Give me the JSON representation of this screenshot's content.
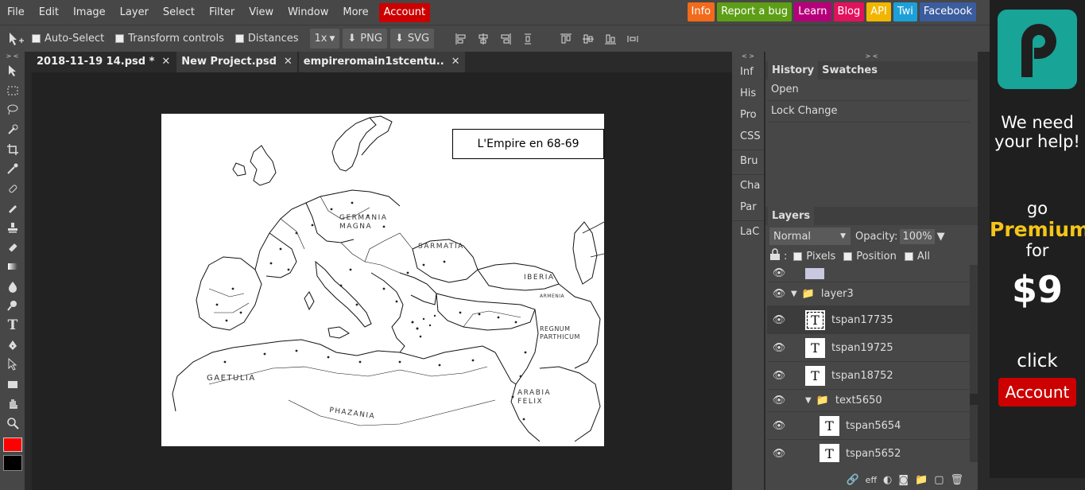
{
  "menubar": {
    "items": [
      "File",
      "Edit",
      "Image",
      "Layer",
      "Select",
      "Filter",
      "View",
      "Window",
      "More"
    ],
    "account": "Account"
  },
  "extlinks": [
    {
      "label": "Info",
      "color": "#f26a1b"
    },
    {
      "label": "Report a bug",
      "color": "#5d9e16"
    },
    {
      "label": "Learn",
      "color": "#b5007a"
    },
    {
      "label": "Blog",
      "color": "#e1125d"
    },
    {
      "label": "API",
      "color": "#f1b600"
    },
    {
      "label": "Twi",
      "color": "#1d9fd8"
    },
    {
      "label": "Facebook",
      "color": "#3b5c9d"
    }
  ],
  "toolbar": {
    "auto_select": "Auto-Select",
    "transform_controls": "Transform controls",
    "distances": "Distances",
    "zoom": "1x",
    "png": "PNG",
    "svg": "SVG"
  },
  "tabs": [
    {
      "label": "2018-11-19 14.psd *"
    },
    {
      "label": "New Project.psd"
    },
    {
      "label": "empireromain1stcentu.."
    }
  ],
  "canvas": {
    "title": "L'Empire en 68-69",
    "labels": {
      "germania": "GERMANIA",
      "magna": "MAGNA",
      "sarmatia": "SARMATIA",
      "iberia": "IBERIA",
      "armenia": "ARMENIA",
      "regnum": "REGNUM",
      "parthicum": "PARTHICUM",
      "gaetulia": "GAETULIA",
      "arabia": "ARABIA",
      "felix": "FELIX",
      "phazania": "PHAZANIA"
    }
  },
  "sidetabs": [
    "Inf",
    "His",
    "Pro",
    "CSS",
    "Bru",
    "Cha",
    "Par",
    "LaC"
  ],
  "history": {
    "tab_history": "History",
    "tab_swatches": "Swatches",
    "items": [
      "Open",
      "Lock Change"
    ]
  },
  "layers": {
    "title": "Layers",
    "blend_mode": "Normal",
    "opacity_label": "Opacity:",
    "opacity_value": "100%",
    "lock_pixels": "Pixels",
    "lock_position": "Position",
    "lock_all": "All",
    "rows": [
      {
        "name": "layer3",
        "type": "folder"
      },
      {
        "name": "tspan17735",
        "type": "text"
      },
      {
        "name": "tspan19725",
        "type": "text"
      },
      {
        "name": "tspan18752",
        "type": "text"
      },
      {
        "name": "text5650",
        "type": "folder"
      },
      {
        "name": "tspan5654",
        "type": "text"
      },
      {
        "name": "tspan5652",
        "type": "text"
      }
    ],
    "footer_eff": "eff"
  },
  "ad": {
    "line1": "We need",
    "line2": "your help!",
    "go": "go",
    "premium": "Premium",
    "for": "for",
    "price": "$9",
    "click": "click",
    "account": "Account"
  },
  "colors": {
    "foreground": "#ff0000",
    "background": "#000000"
  }
}
